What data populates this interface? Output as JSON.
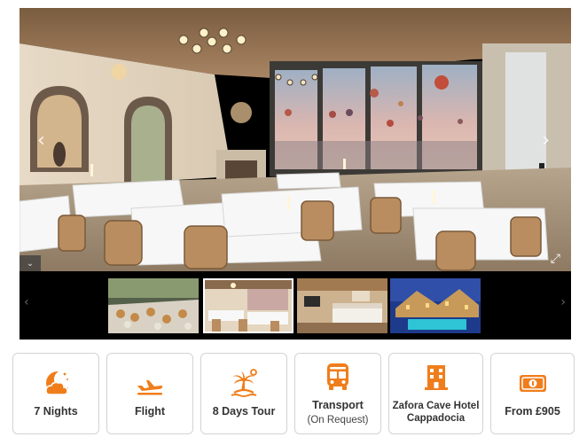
{
  "gallery": {
    "prev_arrow": "‹",
    "next_arrow": "›",
    "collapse_symbol": "⌄",
    "fullscreen_symbol": "⤢",
    "thumb_prev_arrow": "‹",
    "thumb_next_arrow": "›",
    "thumbnails": [
      {
        "name": "buffet",
        "active": false
      },
      {
        "name": "restaurant",
        "active": true
      },
      {
        "name": "bedroom",
        "active": false
      },
      {
        "name": "hotel-night-pool",
        "active": false
      }
    ]
  },
  "features": [
    {
      "icon": "moon-icon",
      "label": "7 Nights",
      "sublabel": ""
    },
    {
      "icon": "plane-icon",
      "label": "Flight",
      "sublabel": ""
    },
    {
      "icon": "island-icon",
      "label": "8 Days Tour",
      "sublabel": ""
    },
    {
      "icon": "bus-icon",
      "label": "Transport",
      "sublabel": "(On Request)"
    },
    {
      "icon": "hotel-icon",
      "label": "Zafora Cave Hotel Cappadocia",
      "sublabel": ""
    },
    {
      "icon": "money-icon",
      "label": "From £905",
      "sublabel": ""
    }
  ],
  "colors": {
    "accent": "#f07d1b",
    "card_border": "#d3d3d3",
    "gallery_bg": "#000000"
  }
}
